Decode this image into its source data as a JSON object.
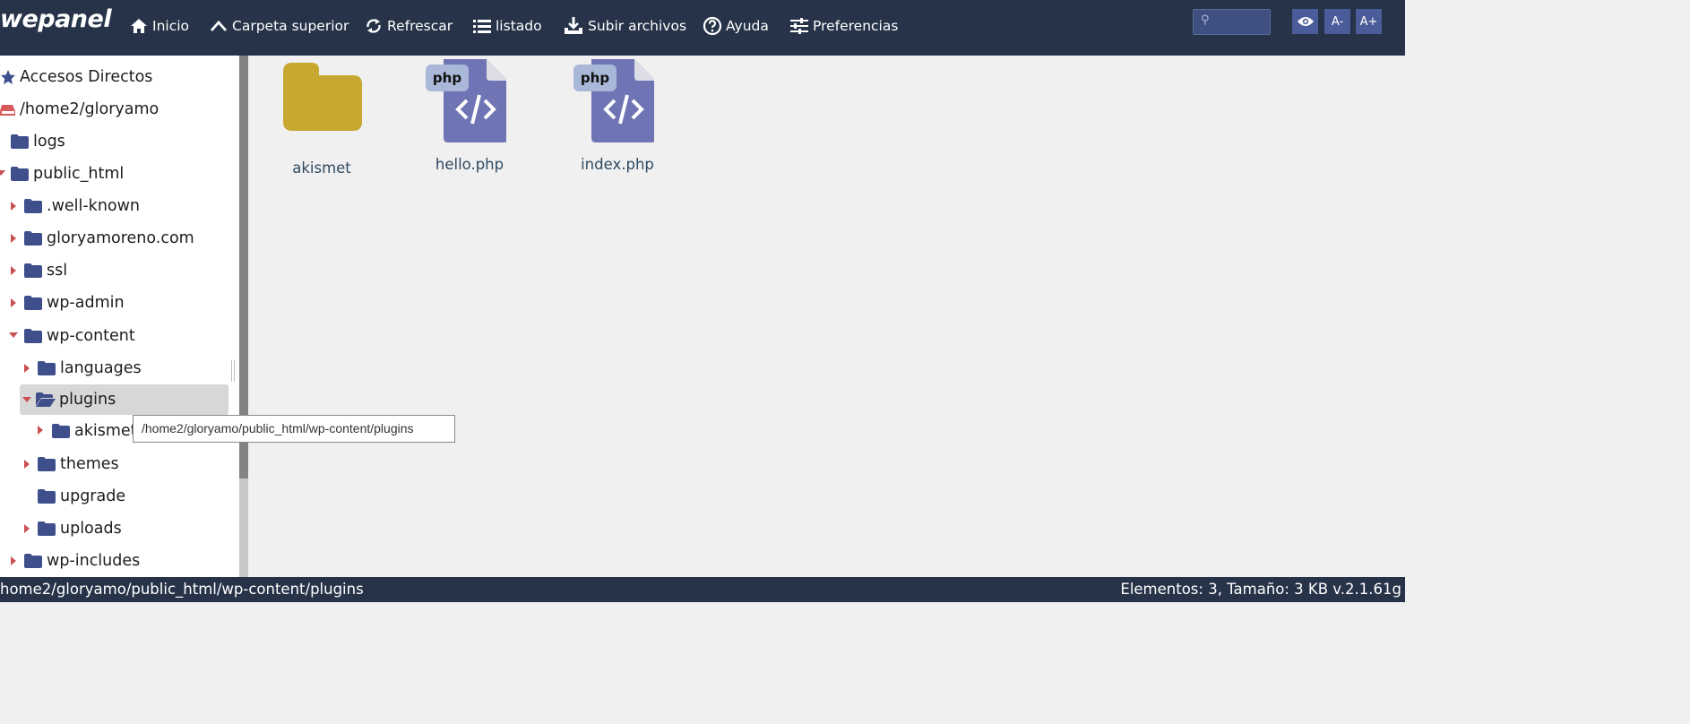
{
  "app": {
    "logo": "wepanel"
  },
  "toolbar": {
    "items": [
      {
        "label": "Inicio",
        "icon": "home-icon"
      },
      {
        "label": "Carpeta superior",
        "icon": "chevron-up-icon"
      },
      {
        "label": "Refrescar",
        "icon": "refresh-icon"
      },
      {
        "label": "listado",
        "icon": "list-icon"
      },
      {
        "label": "Subir archivos",
        "icon": "upload-icon"
      },
      {
        "label": "Ayuda",
        "icon": "help-icon"
      },
      {
        "label": "Preferencias",
        "icon": "sliders-icon"
      }
    ],
    "search_placeholder": "",
    "view_icon": "eye-icon",
    "font_decrease": "A-",
    "font_increase": "A+"
  },
  "sidebar": {
    "shortcuts_label": "Accesos Directos",
    "root_label": "/home2/gloryamo",
    "items": [
      {
        "label": "logs"
      },
      {
        "label": "public_html"
      },
      {
        "label": ".well-known"
      },
      {
        "label": "gloryamoreno.com"
      },
      {
        "label": "ssl"
      },
      {
        "label": "wp-admin"
      },
      {
        "label": "wp-content"
      },
      {
        "label": "languages"
      },
      {
        "label": "plugins"
      },
      {
        "label": "akismet"
      },
      {
        "label": "themes"
      },
      {
        "label": "upgrade"
      },
      {
        "label": "uploads"
      },
      {
        "label": "wp-includes"
      }
    ]
  },
  "tooltip": "/home2/gloryamo/public_html/wp-content/plugins",
  "files": [
    {
      "name": "akismet",
      "type": "folder"
    },
    {
      "name": "hello.php",
      "type": "php",
      "badge": "php"
    },
    {
      "name": "index.php",
      "type": "php",
      "badge": "php"
    }
  ],
  "status": {
    "path": "home2/gloryamo/public_html/wp-content/plugins",
    "summary": "Elementos: 3, Tamaño: 3 KB v.2.1.61g"
  },
  "colors": {
    "topbar": "#263348",
    "folder_tree": "#3f4f8b",
    "folder_main": "#c7a831",
    "php_file": "#6f74b4",
    "php_badge": "#a9b7d8",
    "triangle": "#c94f52"
  }
}
